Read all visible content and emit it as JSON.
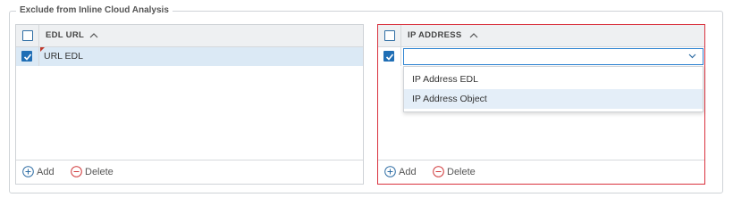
{
  "section": {
    "title": "Exclude from Inline Cloud Analysis"
  },
  "left_grid": {
    "column_header": "EDL URL",
    "rows": [
      {
        "label": "URL EDL",
        "checked": true
      }
    ],
    "add_label": "Add",
    "delete_label": "Delete"
  },
  "right_grid": {
    "column_header": "IP ADDRESS",
    "editor_value": "",
    "add_label": "Add",
    "delete_label": "Delete"
  },
  "dropdown": {
    "options": [
      "IP Address EDL",
      "IP Address Object"
    ],
    "highlighted_index": 1
  },
  "colors": {
    "accent": "#1f6eb5",
    "error_border": "#d9323e",
    "delete_icon": "#d0393b",
    "add_icon": "#2e6da4"
  }
}
